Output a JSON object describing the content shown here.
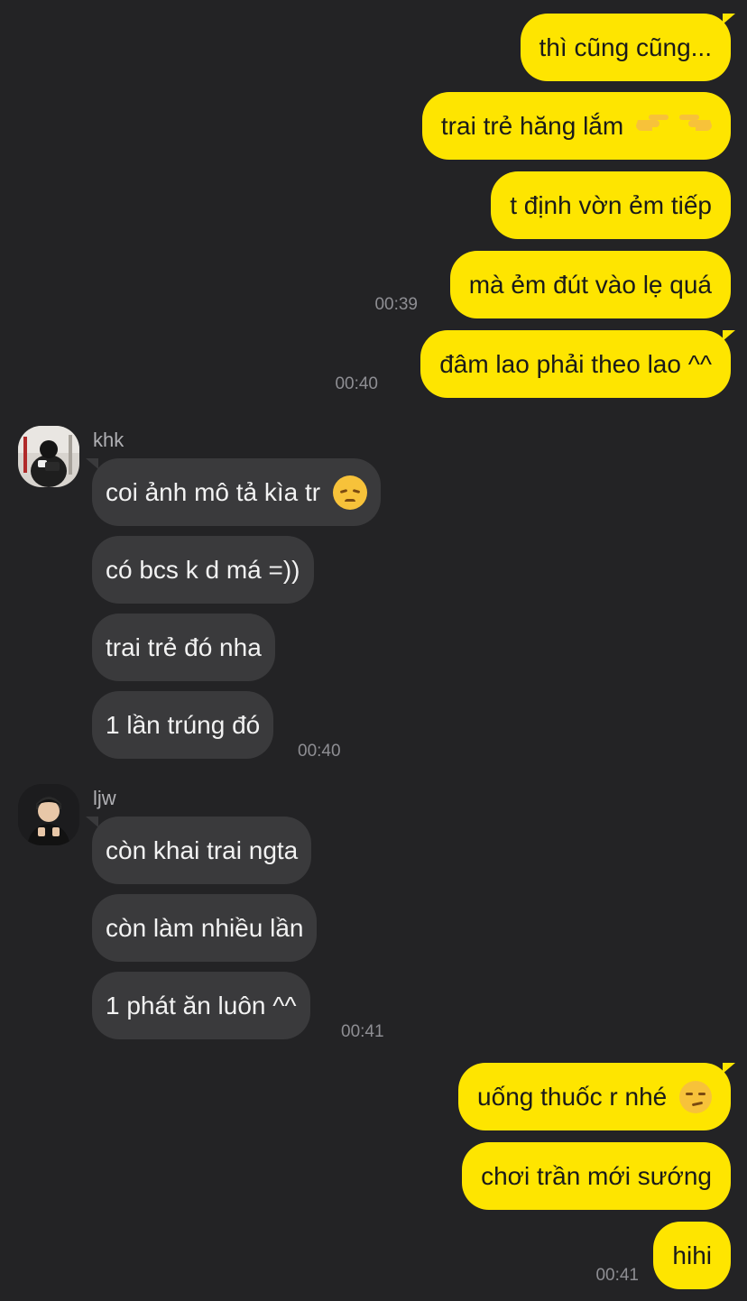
{
  "outgoing_top": [
    {
      "text": "thì cũng cũng..."
    },
    {
      "text": "trai trẻ hăng lắm",
      "emoji": "pointing-hands-emoji"
    },
    {
      "text": "t định vờn ẻm tiếp"
    },
    {
      "text": "mà ẻm đút vào lẹ quá",
      "time": "00:39"
    },
    {
      "text": "đâm lao phải theo lao ^^",
      "time": "00:40"
    }
  ],
  "khk": {
    "name": "khk",
    "messages": [
      {
        "text": "coi ảnh mô tả kìa tr",
        "emoji": "disappointed-face-emoji"
      },
      {
        "text": "có bcs k d má =))"
      },
      {
        "text": "trai trẻ đó nha"
      },
      {
        "text": "1 lần trúng đó",
        "time": "00:40"
      }
    ]
  },
  "ljw": {
    "name": "ljw",
    "messages": [
      {
        "text": "còn khai trai ngta"
      },
      {
        "text": "còn làm nhiều lần"
      },
      {
        "text": "1 phát ăn luôn ^^",
        "time": "00:41"
      }
    ]
  },
  "outgoing_bottom": [
    {
      "text": "uống thuốc r nhé",
      "emoji": "smirking-face-emoji"
    },
    {
      "text": "chơi trần mới sướng"
    },
    {
      "text": "hihi",
      "time": "00:41"
    }
  ],
  "colors": {
    "background": "#232325",
    "outgoing_bubble": "#fee500",
    "incoming_bubble": "#3a3a3c",
    "timestamp": "#8e8e93"
  }
}
